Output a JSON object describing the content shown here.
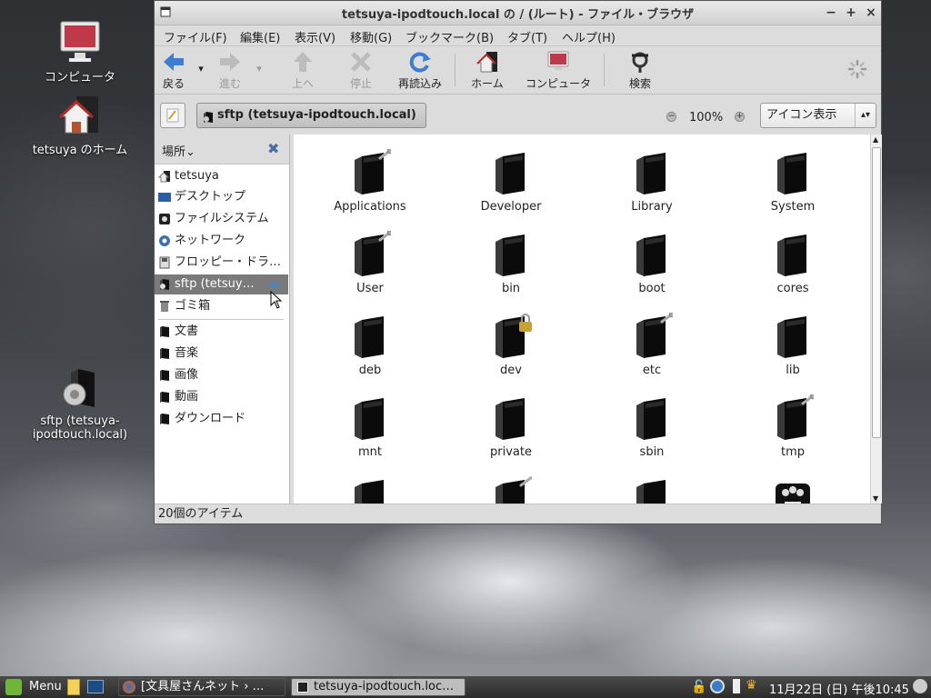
{
  "desktop": {
    "icons": [
      {
        "label": "コンピュータ",
        "icon": "computer-icon"
      },
      {
        "label": "tetsuya のホーム",
        "icon": "home-folder-icon"
      },
      {
        "label": "sftp (tetsuya-\nipodtouch.local)",
        "icon": "network-drive-icon"
      }
    ]
  },
  "window": {
    "title": "tetsuya-ipodtouch.local の / (ルート) - ファイル・ブラウザ",
    "controls": {
      "minimize": "−",
      "maximize": "+",
      "close": "×"
    },
    "menu": [
      "ファイル(F)",
      "編集(E)",
      "表示(V)",
      "移動(G)",
      "ブックマーク(B)",
      "タブ(T)",
      "ヘルプ(H)"
    ],
    "toolbar": {
      "back": "戻る",
      "forward": "進む",
      "up": "上へ",
      "stop": "停止",
      "reload": "再読込み",
      "home": "ホーム",
      "computer": "コンピュータ",
      "search": "検索"
    },
    "location": {
      "path": "sftp (tetsuya-ipodtouch.local)",
      "zoom": "100%",
      "zoom_minus": "−",
      "zoom_plus": "+",
      "view_mode": "アイコン表示"
    },
    "sidebar": {
      "header": "場所",
      "places": [
        {
          "label": "tetsuya",
          "icon": "home-icon"
        },
        {
          "label": "デスクトップ",
          "icon": "desktop-icon"
        },
        {
          "label": "ファイルシステム",
          "icon": "filesystem-icon"
        },
        {
          "label": "ネットワーク",
          "icon": "network-icon"
        },
        {
          "label": "フロッピー・ドラ…",
          "icon": "floppy-icon"
        },
        {
          "label": "sftp (tetsuy…",
          "icon": "network-drive-icon",
          "selected": true
        },
        {
          "label": "ゴミ箱",
          "icon": "trash-icon"
        }
      ],
      "bookmarks": [
        {
          "label": "文書"
        },
        {
          "label": "音楽"
        },
        {
          "label": "画像"
        },
        {
          "label": "動画"
        },
        {
          "label": "ダウンロード"
        }
      ]
    },
    "files": [
      {
        "name": "Applications",
        "link": true
      },
      {
        "name": "Developer",
        "link": false
      },
      {
        "name": "Library",
        "link": false
      },
      {
        "name": "System",
        "link": false
      },
      {
        "name": "User",
        "link": true
      },
      {
        "name": "bin",
        "link": false
      },
      {
        "name": "boot",
        "link": false
      },
      {
        "name": "cores",
        "link": false
      },
      {
        "name": "deb",
        "link": false
      },
      {
        "name": "dev",
        "lock": true
      },
      {
        "name": "etc",
        "link": true
      },
      {
        "name": "lib",
        "link": false
      },
      {
        "name": "mnt",
        "link": false
      },
      {
        "name": "private",
        "link": false
      },
      {
        "name": "sbin",
        "link": false
      },
      {
        "name": "tmp",
        "link": true
      }
    ],
    "status": "20個のアイテム"
  },
  "panel": {
    "menu_label": "Menu",
    "tasks": [
      "[文具屋さんネット › …",
      "tetsuya-ipodtouch.loc…"
    ],
    "clock": "11月22日 (日) 午後10:45"
  }
}
